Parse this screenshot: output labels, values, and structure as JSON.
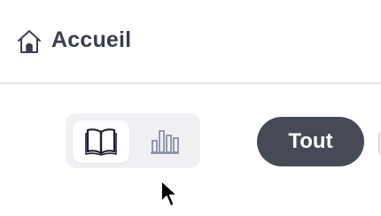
{
  "header": {
    "title": "Accueil",
    "home_icon": "home-icon"
  },
  "view_toggle": {
    "options": [
      {
        "icon": "book-icon",
        "active": true
      },
      {
        "icon": "bar-chart-icon",
        "active": false
      }
    ]
  },
  "filters": {
    "items": [
      {
        "label": "Tout",
        "selected": true
      }
    ]
  },
  "colors": {
    "title_text": "#3b3f4b",
    "pill_bg": "#464a57",
    "toggle_bg": "#f0f0f5",
    "divider": "#e3e4e8",
    "inactive_icon": "#8a8fa3"
  }
}
